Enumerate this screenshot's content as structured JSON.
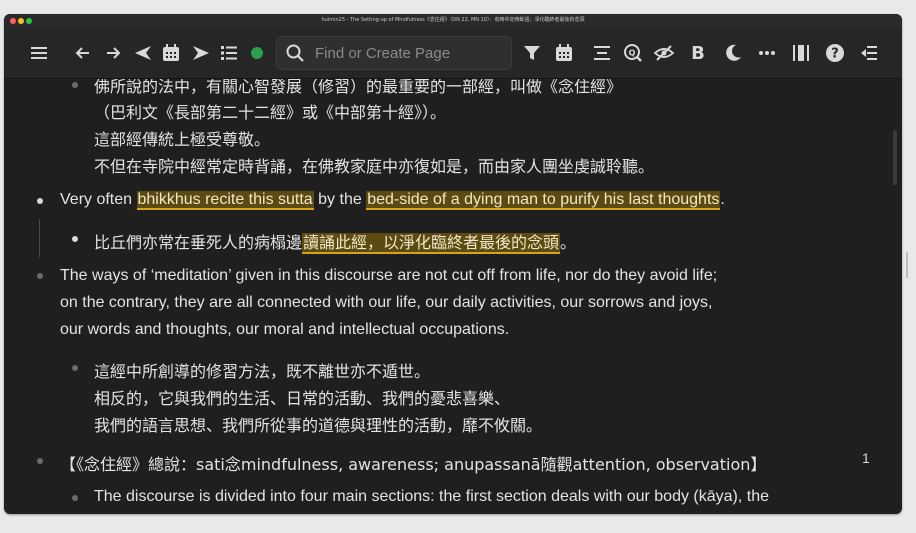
{
  "window": {
    "title": "huimin25 - The Setting-up of Mindfulness《念住經》（DN 22, MN 10）：有時中定時斷語；淨化臨終者最後的念頭"
  },
  "toolbar": {
    "search_placeholder": "Find or Create Page",
    "icons": [
      "menu-icon",
      "back-arrow-icon",
      "forward-arrow-icon",
      "prev-day-icon",
      "calendar-icon",
      "next-day-icon",
      "list-icon",
      "status-dot-icon",
      "search-icon",
      "filter-icon",
      "calendar-icon",
      "align-icon",
      "search-text-icon",
      "hide-icon",
      "bold-icon",
      "moon-icon",
      "more-icon",
      "sidebar-icon",
      "help-icon",
      "collapse-icon"
    ],
    "status_color": "#2aa14a"
  },
  "content": {
    "top_line_partial": "佛所說的法中，有關心智發展（修習）的最重要的一部經，叫做《念住經》",
    "zh_intro": [
      "（巴利文《長部第二十二經》或《中部第十經》）。",
      "這部經傳統上極受尊敬。",
      "不但在寺院中經常定時背誦，在佛教家庭中亦復如是，而由家人團坐虔誠聆聽。"
    ],
    "para1": {
      "pre": "Very often ",
      "hl1": "bhikkhus recite this sutta",
      "mid": " by the ",
      "hl2": "bed-side of a dying man to purify his last thoughts",
      "post": "."
    },
    "para1_zh": {
      "pre": "比丘們亦常在垂死人的病榻邊",
      "hl": "讀誦此經，以淨化臨終者最後的念頭",
      "post": "。"
    },
    "para2": [
      "The ways of ‘meditation’ given in this discourse are not cut off from life, nor do they avoid life;",
      "on the contrary, they are all connected with our life, our daily activities, our sorrows and joys,",
      "our words and thoughts, our moral and intellectual occupations."
    ],
    "para2_zh": [
      "這經中所創導的修習方法，既不離世亦不遁世。",
      "相反的，它與我們的生活、日常的活動、我們的憂悲喜樂、",
      "我們的語言思想、我們所從事的道德與理性的活動，靡不攸關。"
    ],
    "para3": "【《念住經》總說：sati念mindfulness, awareness; anupassanā隨觀attention, observation】",
    "para4_partial": "The discourse is divided into four main sections: the first section deals with our body (kāya), the",
    "page_number": "1"
  },
  "colors": {
    "highlight_bg": "#5b4a12",
    "highlight_underline": "#d6a31a",
    "text": "#e3e3e3",
    "background": "#1f1f1f"
  }
}
